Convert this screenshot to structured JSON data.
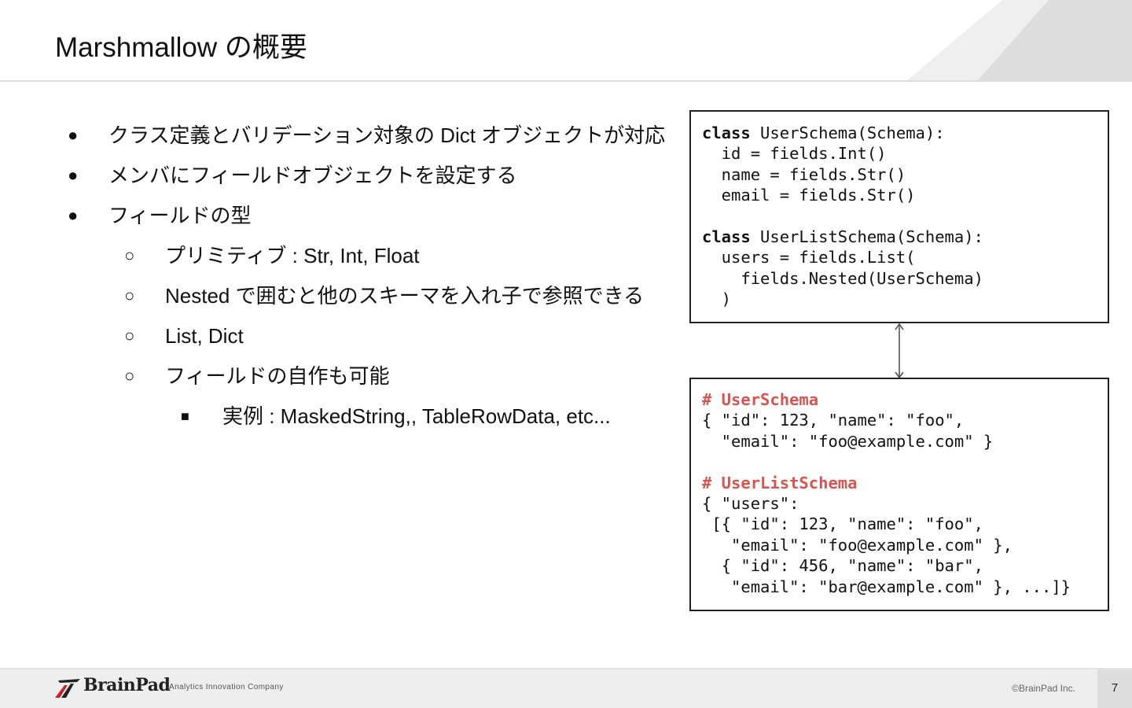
{
  "slide": {
    "title": "Marshmallow の概要",
    "page_number": "7"
  },
  "bullets": [
    {
      "level": 1,
      "marker": "●",
      "text": "クラス定義とバリデーション対象の Dict オブジェクトが対応"
    },
    {
      "level": 1,
      "marker": "●",
      "text": "メンバにフィールドオブジェクトを設定する"
    },
    {
      "level": 1,
      "marker": "●",
      "text": "フィールドの型"
    },
    {
      "level": 2,
      "marker": "○",
      "text": "プリミティブ : Str, Int, Float"
    },
    {
      "level": 2,
      "marker": "○",
      "text": "Nested で囲むと他のスキーマを入れ子で参照できる"
    },
    {
      "level": 2,
      "marker": "○",
      "text": "List, Dict"
    },
    {
      "level": 2,
      "marker": "○",
      "text": "フィールドの自作も可能"
    },
    {
      "level": 3,
      "marker": "■",
      "text": "実例 : MaskedString,, TableRowData, etc..."
    }
  ],
  "schema_code": {
    "kw_class": "class",
    "line1_rest": " UserSchema(Schema):",
    "line2": "  id = fields.Int()",
    "line3": "  name = fields.Str()",
    "line4": "  email = fields.Str()",
    "line6_rest": " UserListSchema(Schema):",
    "line7": "  users = fields.List(",
    "line8": "    fields.Nested(UserSchema)",
    "line9": "  )"
  },
  "json_example": {
    "comment1": "# UserSchema",
    "line2": "{ \"id\": 123, \"name\": \"foo\",",
    "line3": "  \"email\": \"foo@example.com\" }",
    "comment2": "# UserListSchema",
    "line6": "{ \"users\":",
    "line7": " [{ \"id\": 123, \"name\": \"foo\",",
    "line8": "   \"email\": \"foo@example.com\" },",
    "line9": "  { \"id\": 456, \"name\": \"bar\",",
    "line10": "   \"email\": \"bar@example.com\" }, ...]}"
  },
  "footer": {
    "logo_text": "BrainPad",
    "tagline": "Analytics Innovation Company",
    "copyright": "©BrainPad Inc."
  },
  "colors": {
    "comment": "#d9534f",
    "footer_bg": "#eeeeee",
    "header_deco_light": "#efefef",
    "header_deco_dark": "#dddddd",
    "logo_red": "#c0272d"
  },
  "icons": {
    "connector": "double-arrow-vertical",
    "logo": "brainpad-logo-mark"
  }
}
